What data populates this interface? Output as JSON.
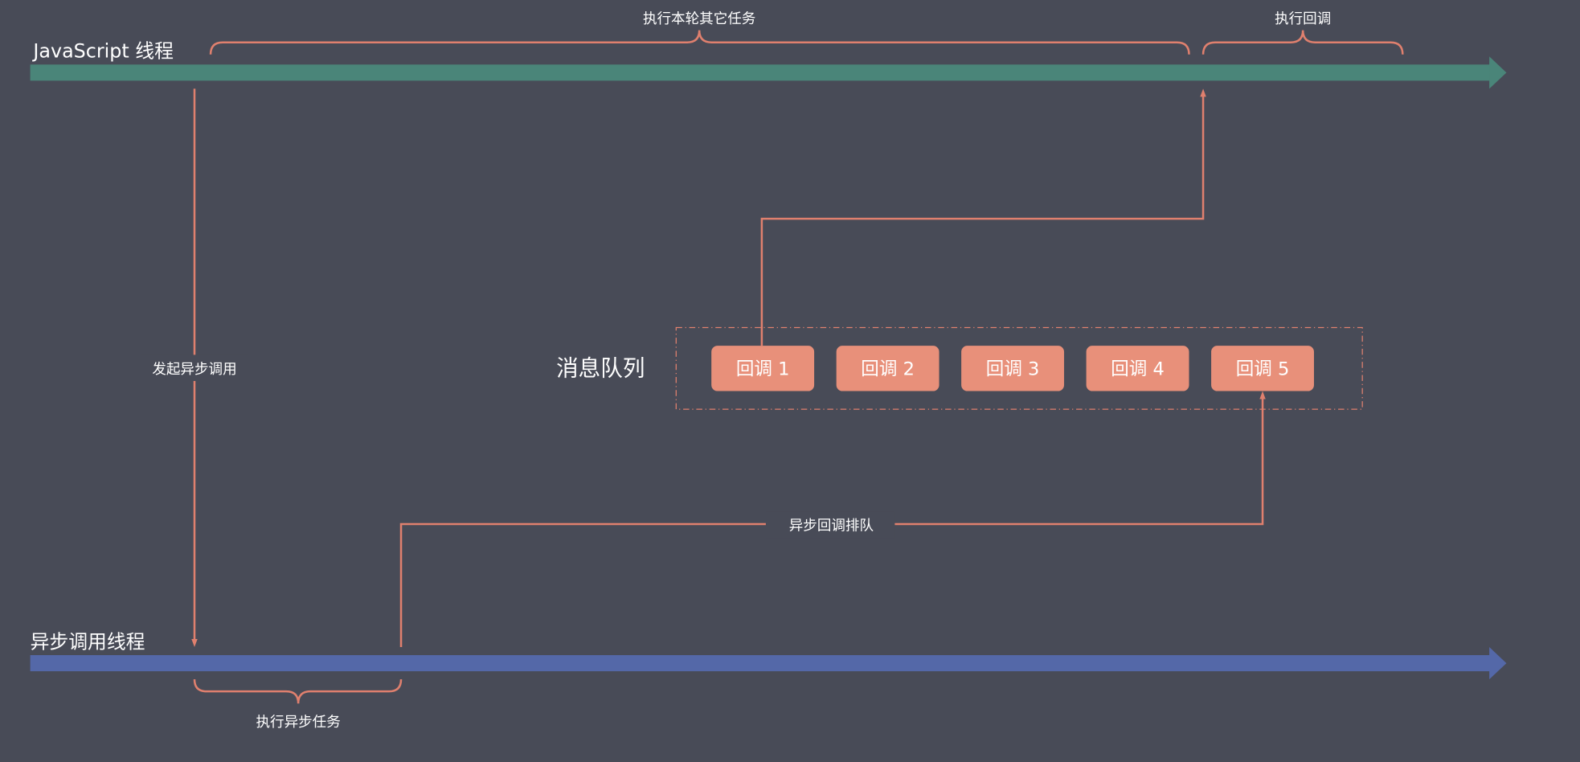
{
  "threads": {
    "js_thread": "JavaScript 线程",
    "async_thread": "异步调用线程"
  },
  "braces": {
    "run_other_tasks": "执行本轮其它任务",
    "run_callback": "执行回调",
    "run_async_task": "执行异步任务"
  },
  "arrows": {
    "start_async_call": "发起异步调用",
    "queue_async_callback": "异步回调排队"
  },
  "queue": {
    "label": "消息队列",
    "items": [
      "回调 1",
      "回调 2",
      "回调 3",
      "回调 4",
      "回调 5"
    ]
  },
  "colors": {
    "background": "#484b57",
    "js_thread": "#4a8579",
    "async_thread": "#5468a8",
    "accent": "#e0806e",
    "callback_box": "#e8907a"
  }
}
